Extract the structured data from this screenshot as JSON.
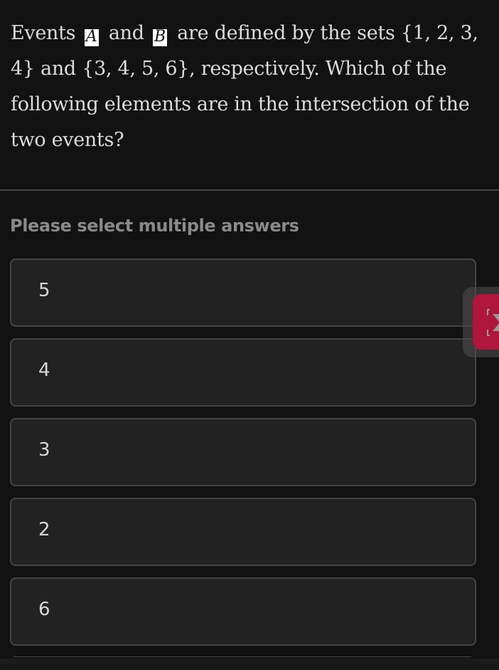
{
  "question": {
    "part1": "Events ",
    "var_a": "A",
    "part2": " and ",
    "var_b": "B",
    "part3": " are defined by the sets {1, 2, 3, 4} and {3, 4, 5, 6}, respectively. Which of the following elements are in the intersection of the two events?"
  },
  "instruction": "Please select multiple answers",
  "options": [
    {
      "label": "5"
    },
    {
      "label": "4"
    },
    {
      "label": "3"
    },
    {
      "label": "2"
    },
    {
      "label": "6"
    }
  ],
  "side_tab": {
    "icon": "chevron-right-icon",
    "accent_color": "#b0153a"
  }
}
